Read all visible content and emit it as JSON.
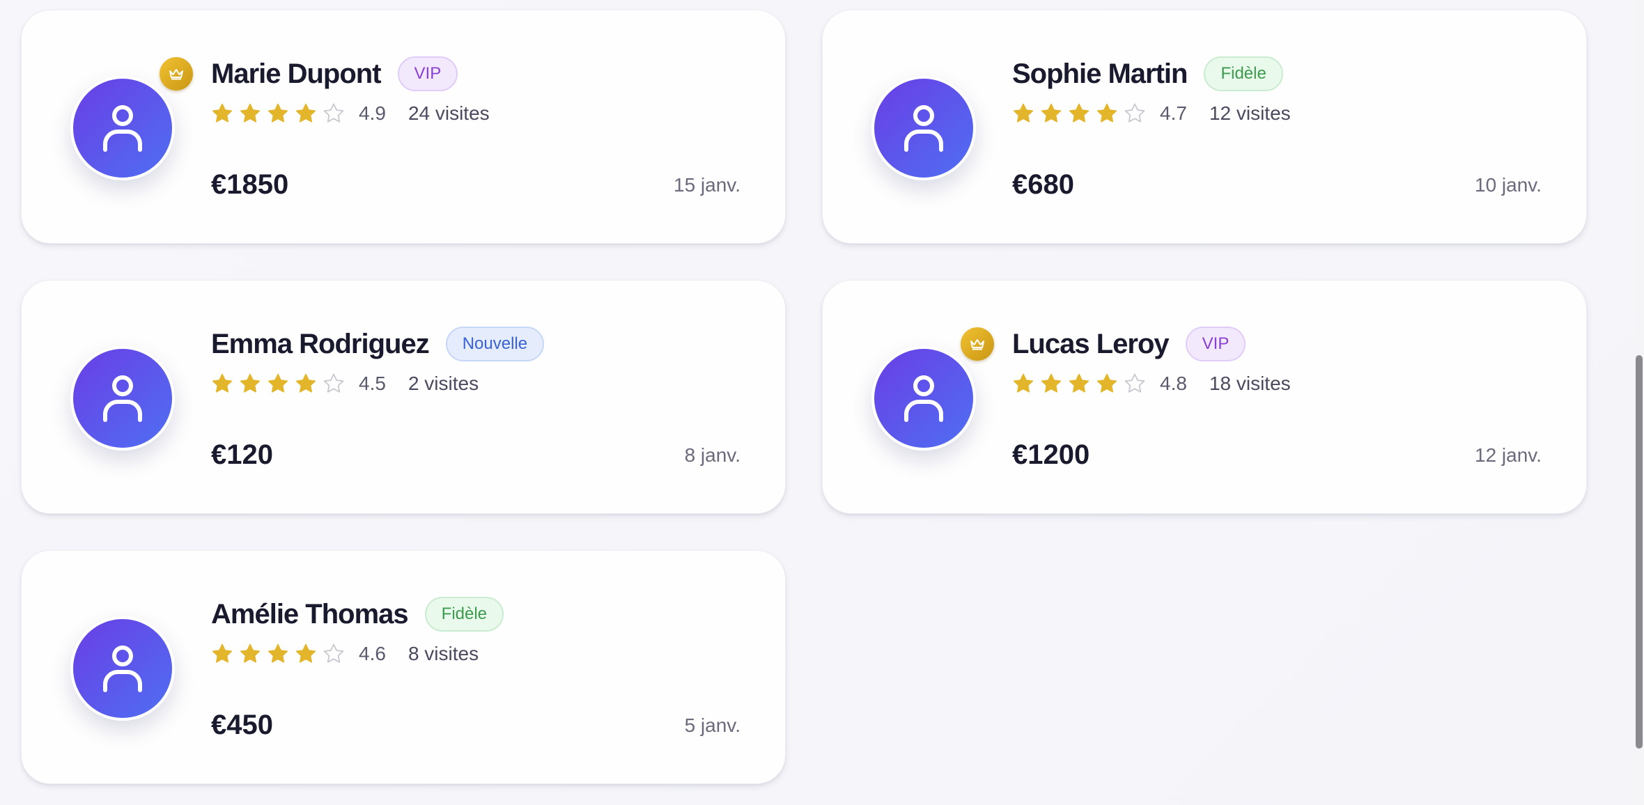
{
  "colors": {
    "gold": "#e3b52a",
    "avatar_from": "#6a3ee6",
    "avatar_to": "#4f6ff2"
  },
  "clients": [
    {
      "name": "Marie Dupont",
      "badge": "VIP",
      "badge_type": "vip",
      "crown": true,
      "stars": 4,
      "stars_max": 5,
      "rating": "4.9",
      "visits": "24 visites",
      "amount": "€1850",
      "date": "15 janv."
    },
    {
      "name": "Sophie Martin",
      "badge": "Fidèle",
      "badge_type": "fidele",
      "crown": false,
      "stars": 4,
      "stars_max": 5,
      "rating": "4.7",
      "visits": "12 visites",
      "amount": "€680",
      "date": "10 janv."
    },
    {
      "name": "Emma Rodriguez",
      "badge": "Nouvelle",
      "badge_type": "nouvelle",
      "crown": false,
      "stars": 4,
      "stars_max": 5,
      "rating": "4.5",
      "visits": "2 visites",
      "amount": "€120",
      "date": "8 janv."
    },
    {
      "name": "Lucas Leroy",
      "badge": "VIP",
      "badge_type": "vip",
      "crown": true,
      "stars": 4,
      "stars_max": 5,
      "rating": "4.8",
      "visits": "18 visites",
      "amount": "€1200",
      "date": "12 janv."
    },
    {
      "name": "Amélie Thomas",
      "badge": "Fidèle",
      "badge_type": "fidele",
      "crown": false,
      "stars": 4,
      "stars_max": 5,
      "rating": "4.6",
      "visits": "8 visites",
      "amount": "€450",
      "date": "5 janv."
    }
  ],
  "icons": {
    "avatar": "user-icon",
    "crown": "crown-icon",
    "star_filled": "star-icon",
    "star_empty": "star-outline-icon"
  }
}
